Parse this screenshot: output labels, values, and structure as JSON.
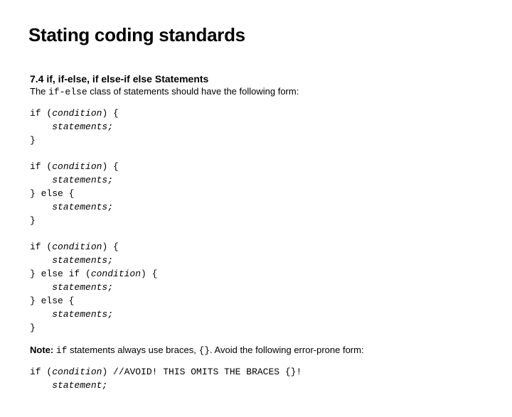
{
  "title": "Stating coding standards",
  "section": {
    "heading": "7.4 if, if-else, if else-if else Statements",
    "intro_prefix": "The ",
    "intro_code": "if-else",
    "intro_suffix": " class of statements should have the following form:",
    "code_block1": "if (condition) {\n    statements;\n}\n\nif (condition) {\n    statements;\n} else {\n    statements;\n}\n\nif (condition) {\n    statements;\n} else if (condition) {\n    statements;\n} else {\n    statements;\n}",
    "note_label": "Note:",
    "note_code1": "if",
    "note_mid": " statements always use braces, ",
    "note_code2": "{}",
    "note_suffix": ". Avoid the following error-prone form:",
    "code_block2": "if (condition) //AVOID! THIS OMITS THE BRACES {}!\n    statement;"
  }
}
